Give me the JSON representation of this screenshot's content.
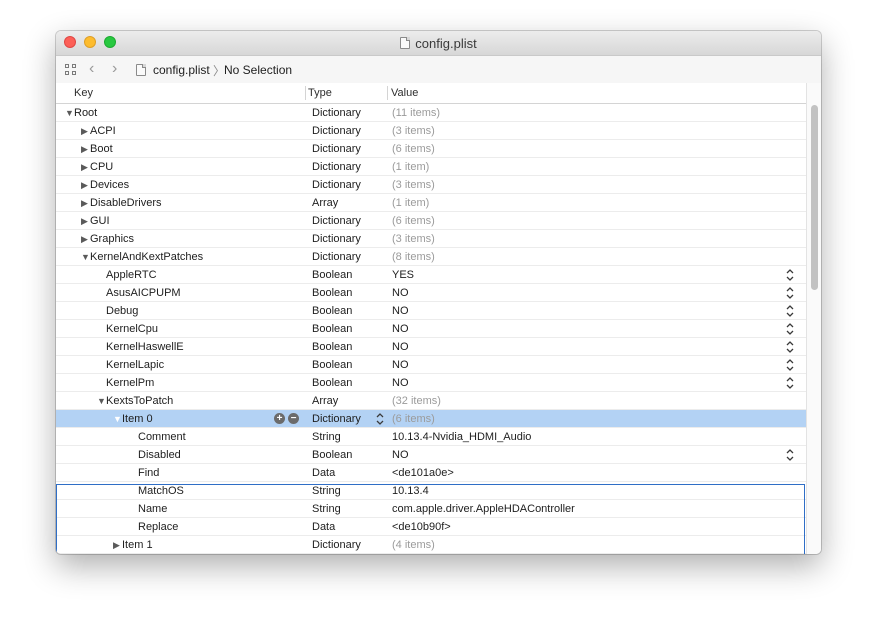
{
  "window": {
    "title": "config.plist"
  },
  "jumpbar": {
    "file": "config.plist",
    "separator": "〉",
    "selection": "No Selection"
  },
  "columns": {
    "key": "Key",
    "type": "Type",
    "value": "Value"
  },
  "rows": [
    {
      "key": "Root",
      "type": "Dictionary",
      "value": "(11 items)",
      "level": 0,
      "tri": "down",
      "muted": true
    },
    {
      "key": "ACPI",
      "type": "Dictionary",
      "value": "(3 items)",
      "level": 1,
      "tri": "right",
      "muted": true
    },
    {
      "key": "Boot",
      "type": "Dictionary",
      "value": "(6 items)",
      "level": 1,
      "tri": "right",
      "muted": true
    },
    {
      "key": "CPU",
      "type": "Dictionary",
      "value": "(1 item)",
      "level": 1,
      "tri": "right",
      "muted": true
    },
    {
      "key": "Devices",
      "type": "Dictionary",
      "value": "(3 items)",
      "level": 1,
      "tri": "right",
      "muted": true
    },
    {
      "key": "DisableDrivers",
      "type": "Array",
      "value": "(1 item)",
      "level": 1,
      "tri": "right",
      "muted": true
    },
    {
      "key": "GUI",
      "type": "Dictionary",
      "value": "(6 items)",
      "level": 1,
      "tri": "right",
      "muted": true
    },
    {
      "key": "Graphics",
      "type": "Dictionary",
      "value": "(3 items)",
      "level": 1,
      "tri": "right",
      "muted": true
    },
    {
      "key": "KernelAndKextPatches",
      "type": "Dictionary",
      "value": "(8 items)",
      "level": 1,
      "tri": "down",
      "muted": true
    },
    {
      "key": "AppleRTC",
      "type": "Boolean",
      "value": "YES",
      "level": 2,
      "tri": "none",
      "stepper": true
    },
    {
      "key": "AsusAICPUPM",
      "type": "Boolean",
      "value": "NO",
      "level": 2,
      "tri": "none",
      "stepper": true
    },
    {
      "key": "Debug",
      "type": "Boolean",
      "value": "NO",
      "level": 2,
      "tri": "none",
      "stepper": true
    },
    {
      "key": "KernelCpu",
      "type": "Boolean",
      "value": "NO",
      "level": 2,
      "tri": "none",
      "stepper": true
    },
    {
      "key": "KernelHaswellE",
      "type": "Boolean",
      "value": "NO",
      "level": 2,
      "tri": "none",
      "stepper": true
    },
    {
      "key": "KernelLapic",
      "type": "Boolean",
      "value": "NO",
      "level": 2,
      "tri": "none",
      "stepper": true
    },
    {
      "key": "KernelPm",
      "type": "Boolean",
      "value": "NO",
      "level": 2,
      "tri": "none",
      "stepper": true
    },
    {
      "key": "KextsToPatch",
      "type": "Array",
      "value": "(32 items)",
      "level": 2,
      "tri": "down",
      "muted": true
    },
    {
      "key": "Item 0",
      "type": "Dictionary",
      "value": "(6 items)",
      "level": 3,
      "tri": "down",
      "muted": true,
      "selected": true
    },
    {
      "key": "Comment",
      "type": "String",
      "value": "10.13.4-Nvidia_HDMI_Audio",
      "level": 4,
      "tri": "none"
    },
    {
      "key": "Disabled",
      "type": "Boolean",
      "value": "NO",
      "level": 4,
      "tri": "none",
      "stepper": true
    },
    {
      "key": "Find",
      "type": "Data",
      "value": "<de101a0e>",
      "level": 4,
      "tri": "none"
    },
    {
      "key": "MatchOS",
      "type": "String",
      "value": "10.13.4",
      "level": 4,
      "tri": "none"
    },
    {
      "key": "Name",
      "type": "String",
      "value": "com.apple.driver.AppleHDAController",
      "level": 4,
      "tri": "none"
    },
    {
      "key": "Replace",
      "type": "Data",
      "value": "<de10b90f>",
      "level": 4,
      "tri": "none"
    },
    {
      "key": "Item 1",
      "type": "Dictionary",
      "value": "(4 items)",
      "level": 3,
      "tri": "right",
      "muted": true
    }
  ],
  "icons": {
    "add": "+",
    "remove": "−",
    "tri_down": "▼",
    "tri_right": "▶",
    "back": "‹",
    "forward": "›"
  }
}
